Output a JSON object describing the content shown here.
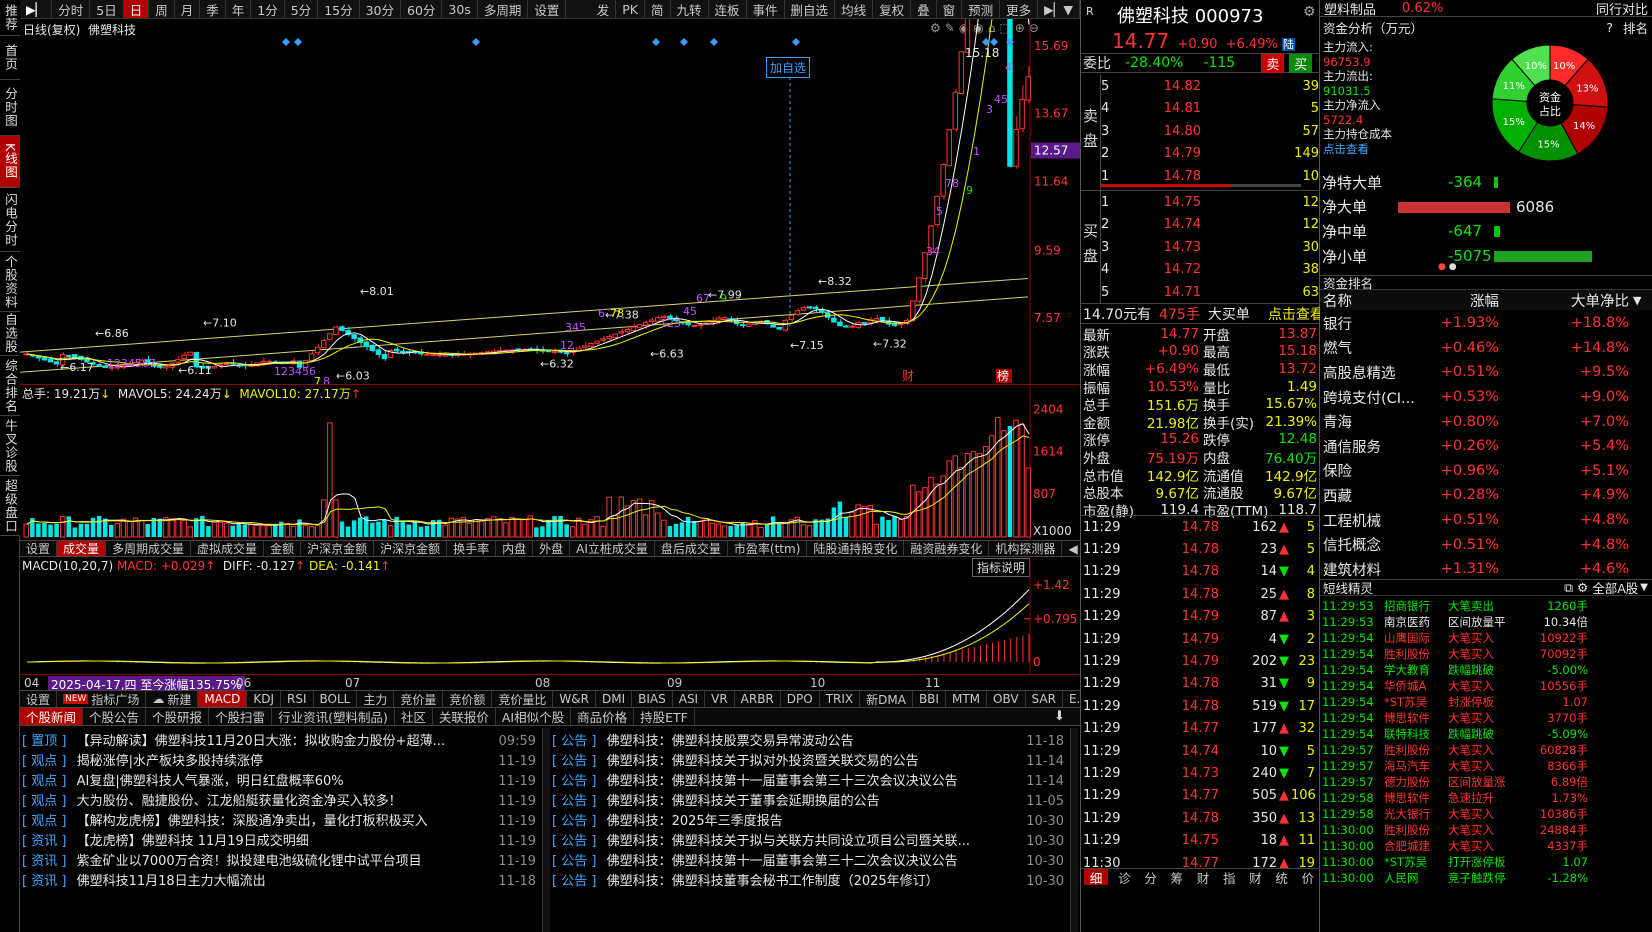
{
  "toolbar": {
    "left": [
      "分时",
      "5日",
      "日",
      "周",
      "月",
      "季",
      "年",
      "1分",
      "5分",
      "15分",
      "30分",
      "60分",
      "30s",
      "多周期",
      "设置"
    ],
    "active": 2,
    "right": [
      "发",
      "PK",
      "简",
      "九转",
      "连板",
      "事件",
      "删自选",
      "均线",
      "复权",
      "叠",
      "窗",
      "预测",
      "更多"
    ]
  },
  "sidebar": [
    "推荐",
    "首页",
    "分时图",
    "K线图",
    "闪电分时",
    "个股资料",
    "自选股",
    "综合排名",
    "牛叉诊股",
    "超级盘口"
  ],
  "sidebar_active": 3,
  "kline": {
    "title_left": "日线(复权)",
    "stock_name": "佛塑科技",
    "price_labels": [
      "15.69",
      "13.67",
      "12.57",
      "11.64",
      "9.59",
      "7.57"
    ],
    "marks": {
      "high": "15.18",
      "p801": "8.01",
      "p832": "8.32",
      "p799": "7.99",
      "p738": "7.38",
      "p715": "7.15",
      "p732": "7.32",
      "p710": "7.10",
      "p686": "6.86",
      "p617": "6.17",
      "p611": "6.11",
      "p603": "6.03",
      "p632": "6.32",
      "p663": "6.63"
    },
    "add_watch": "加自选",
    "cai": "财",
    "bang": "榜"
  },
  "volume": {
    "label_main": "总手: 19.21万",
    "label_mavol5": "MAVOL5: 24.24万",
    "label_mavol10": "MAVOL10: 27.17万",
    "ticks": [
      "2404",
      "1614",
      "807",
      "X1000"
    ]
  },
  "ind_tabs": [
    "设置",
    "成交量",
    "多周期成交量",
    "虚拟成交量",
    "金额",
    "沪深京金额",
    "沪深京金额",
    "换手率",
    "内盘",
    "外盘",
    "AI立桩成交量",
    "盘后成交量",
    "市盈率(ttm)",
    "陆股通持股变化",
    "融资融券变化",
    "机构探测器"
  ],
  "ind_tabs_active": 1,
  "macd": {
    "label": "MACD(10,20,7)",
    "macd": "MACD: +0.029",
    "diff": "DIFF: -0.127",
    "dea": "DEA: -0.141",
    "btn": "指标说明",
    "ticks": [
      "+1.42",
      "+0.795",
      "0"
    ]
  },
  "xaxis": {
    "labels": [
      "04",
      "2025-04-17,四 至今涨幅135.75%",
      "06",
      "07",
      "08",
      "09",
      "10",
      "11"
    ]
  },
  "ind_bar": [
    "设置",
    "指标广场",
    "新建",
    "MACD",
    "KDJ",
    "RSI",
    "BOLL",
    "主力",
    "竞价量",
    "竞价额",
    "竞价量比",
    "W&R",
    "DMI",
    "BIAS",
    "ASI",
    "VR",
    "ARBR",
    "DPO",
    "TRIX",
    "新DMA",
    "BBI",
    "MTM",
    "OBV",
    "SAR",
    "E..."
  ],
  "ind_bar_new": "NEW",
  "news_tabs": [
    "个股新闻",
    "个股公告",
    "个股研报",
    "个股扫雷",
    "行业资讯(塑料制品)",
    "社区",
    "关联报价",
    "AI相似个股",
    "商品价格",
    "持股ETF"
  ],
  "news_left": [
    {
      "tag": "置顶",
      "text": "【异动解读】佛塑科技11月20日大涨：拟收购金力股份+超薄...",
      "date": "09:59"
    },
    {
      "tag": "观点",
      "text": "揭秘涨停|水产板块多股持续涨停",
      "date": "11-19"
    },
    {
      "tag": "观点",
      "text": "AI复盘|佛塑科技人气暴涨，明日红盘概率60%",
      "date": "11-19"
    },
    {
      "tag": "观点",
      "text": "大为股份、融捷股份、江龙船艇获量化资金净买入较多！",
      "date": "11-19"
    },
    {
      "tag": "观点",
      "text": "【解构龙虎榜】佛塑科技：深股通净卖出，量化打板积极买入",
      "date": "11-19"
    },
    {
      "tag": "资讯",
      "text": "【龙虎榜】佛塑科技 11月19日成交明细",
      "date": "11-19"
    },
    {
      "tag": "资讯",
      "text": "紫金矿业以7000万合资！拟投建电池级硫化锂中试平台项目",
      "date": "11-19"
    },
    {
      "tag": "资讯",
      "text": "佛塑科技11月18日主力大幅流出",
      "date": "11-18"
    }
  ],
  "news_right": [
    {
      "tag": "公告",
      "text": "佛塑科技：佛塑科技股票交易异常波动公告",
      "date": "11-18"
    },
    {
      "tag": "公告",
      "text": "佛塑科技：佛塑科技关于拟对外投资暨关联交易的公告",
      "date": "11-14"
    },
    {
      "tag": "公告",
      "text": "佛塑科技：佛塑科技第十一届董事会第三十三次会议决议公告",
      "date": "11-14"
    },
    {
      "tag": "公告",
      "text": "佛塑科技：佛塑科技关于董事会延期换届的公告",
      "date": "11-05"
    },
    {
      "tag": "公告",
      "text": "佛塑科技：2025年三季度报告",
      "date": "10-30"
    },
    {
      "tag": "公告",
      "text": "佛塑科技：佛塑科技关于拟与关联方共同设立项目公司暨关联...",
      "date": "10-30"
    },
    {
      "tag": "公告",
      "text": "佛塑科技：佛塑科技第十一届董事会第三十二次会议决议公告",
      "date": "10-30"
    },
    {
      "tag": "公告",
      "text": "佛塑科技：佛塑科技董事会秘书工作制度（2025年修订）",
      "date": "10-30"
    }
  ],
  "quote": {
    "r": "R",
    "name": "佛塑科技",
    "code": "000973",
    "price": "14.77",
    "chg": "+0.90",
    "pct": "+6.49%",
    "lu": "陆",
    "weibi_label": "委比",
    "weibi": "-28.40%",
    "weicha": "-115",
    "sell": "卖",
    "buy": "买",
    "sell_label": "卖盘",
    "buy_label": "买盘",
    "asks": [
      {
        "n": "5",
        "p": "14.82",
        "v": "39"
      },
      {
        "n": "4",
        "p": "14.81",
        "v": "5"
      },
      {
        "n": "3",
        "p": "14.80",
        "v": "57"
      },
      {
        "n": "2",
        "p": "14.79",
        "v": "149"
      },
      {
        "n": "1",
        "p": "14.78",
        "v": "10"
      }
    ],
    "bids": [
      {
        "n": "1",
        "p": "14.75",
        "v": "12"
      },
      {
        "n": "2",
        "p": "14.74",
        "v": "12"
      },
      {
        "n": "3",
        "p": "14.73",
        "v": "30"
      },
      {
        "n": "4",
        "p": "14.72",
        "v": "38"
      },
      {
        "n": "5",
        "p": "14.71",
        "v": "63"
      }
    ],
    "bigorder": {
      "a": "14.70元有",
      "b": "475手",
      "c": "大买单",
      "d": "点击查看"
    },
    "stats": [
      [
        "最新",
        "14.77",
        "开盘",
        "13.87"
      ],
      [
        "涨跌",
        "+0.90",
        "最高",
        "15.18"
      ],
      [
        "涨幅",
        "+6.49%",
        "最低",
        "13.72"
      ],
      [
        "振幅",
        "10.53%",
        "量比",
        "1.49"
      ],
      [
        "总手",
        "151.6万",
        "换手",
        "15.67%"
      ],
      [
        "金额",
        "21.98亿",
        "换手(实)",
        "21.39%"
      ],
      [
        "涨停",
        "15.26",
        "跌停",
        "12.48"
      ],
      [
        "外盘",
        "75.19万",
        "内盘",
        "76.40万"
      ],
      [
        "总市值",
        "142.9亿",
        "流通值",
        "142.9亿"
      ],
      [
        "总股本",
        "9.67亿",
        "流通股",
        "9.67亿"
      ],
      [
        "市盈(静)",
        "119.4",
        "市盈(TTM)",
        "118.7"
      ]
    ],
    "trades": [
      [
        "11:29",
        "14.78",
        "162",
        "5"
      ],
      [
        "11:29",
        "14.78",
        "23",
        "5"
      ],
      [
        "11:29",
        "14.78",
        "14",
        "4"
      ],
      [
        "11:29",
        "14.78",
        "25",
        "8"
      ],
      [
        "11:29",
        "14.79",
        "87",
        "3"
      ],
      [
        "11:29",
        "14.79",
        "4",
        "2"
      ],
      [
        "11:29",
        "14.79",
        "202",
        "23"
      ],
      [
        "11:29",
        "14.78",
        "31",
        "9"
      ],
      [
        "11:29",
        "14.78",
        "519",
        "17"
      ],
      [
        "11:29",
        "14.77",
        "177",
        "32"
      ],
      [
        "11:29",
        "14.74",
        "10",
        "5"
      ],
      [
        "11:29",
        "14.73",
        "240",
        "7"
      ],
      [
        "11:29",
        "14.77",
        "505",
        "106"
      ],
      [
        "11:29",
        "14.78",
        "350",
        "13"
      ],
      [
        "11:29",
        "14.75",
        "18",
        "11"
      ],
      [
        "11:30",
        "14.77",
        "172",
        "19"
      ]
    ],
    "bottom_tabs": [
      "细",
      "诊",
      "分",
      "筹",
      "财",
      "指",
      "财",
      "统",
      "价"
    ]
  },
  "fund": {
    "sector": "塑料制品",
    "sector_pct": "0.62%",
    "peer": "同行对比",
    "title": "资金分析（万元）",
    "help": "?",
    "rank": "排名",
    "inflow_label": "主力流入:",
    "inflow": "96753.9",
    "outflow_label": "主力流出:",
    "outflow": "91031.5",
    "net_label": "主力净流入",
    "net": "5722.4",
    "cost_label": "主力持仓成本",
    "cost_link": "点击查看",
    "donut_center": "资金占比",
    "donut": [
      "10%",
      "10%",
      "11%",
      "15%",
      "15%",
      "14%",
      "13%"
    ],
    "flows": [
      {
        "label": "净特大单",
        "val": "-364"
      },
      {
        "label": "净大单",
        "val": "6086"
      },
      {
        "label": "净中单",
        "val": "-647"
      },
      {
        "label": "净小单",
        "val": "-5075"
      }
    ]
  },
  "sector_rank": {
    "title": "资金排名",
    "cols": [
      "名称",
      "涨幅",
      "大单净比"
    ],
    "rows": [
      [
        "银行",
        "+1.93%",
        "+18.8%"
      ],
      [
        "燃气",
        "+0.46%",
        "+14.8%"
      ],
      [
        "高股息精选",
        "+0.51%",
        "+9.5%"
      ],
      [
        "跨境支付(CI...",
        "+0.53%",
        "+9.0%"
      ],
      [
        "青海",
        "+0.80%",
        "+7.0%"
      ],
      [
        "通信服务",
        "+0.26%",
        "+5.4%"
      ],
      [
        "保险",
        "+0.96%",
        "+5.1%"
      ],
      [
        "西藏",
        "+0.28%",
        "+4.9%"
      ],
      [
        "工程机械",
        "+0.51%",
        "+4.8%"
      ],
      [
        "信托概念",
        "+0.51%",
        "+4.8%"
      ],
      [
        "建筑材料",
        "+1.31%",
        "+4.6%"
      ]
    ]
  },
  "elves": {
    "title": "短线精灵",
    "market": "全部A股",
    "rows": [
      [
        "11:29:53",
        "招商银行",
        "大笔卖出",
        "1260手",
        "g"
      ],
      [
        "11:29:53",
        "南京医药",
        "区间放量平",
        "10.34倍",
        "w"
      ],
      [
        "11:29:54",
        "山鹰国际",
        "大笔买入",
        "10922手",
        "r"
      ],
      [
        "11:29:54",
        "胜利股份",
        "大笔买入",
        "70092手",
        "r"
      ],
      [
        "11:29:54",
        "学大教育",
        "跌幅跳破",
        "-5.00%",
        "g"
      ],
      [
        "11:29:54",
        "华侨城A",
        "大笔买入",
        "10556手",
        "r"
      ],
      [
        "11:29:54",
        "*ST苏吴",
        "封涨停板",
        "1.07",
        "r"
      ],
      [
        "11:29:54",
        "博思软件",
        "大笔买入",
        "3770手",
        "r"
      ],
      [
        "11:29:54",
        "联特科技",
        "跌幅跳破",
        "-5.09%",
        "g"
      ],
      [
        "11:29:57",
        "胜利股份",
        "大笔买入",
        "60828手",
        "r"
      ],
      [
        "11:29:57",
        "海马汽车",
        "大笔买入",
        "8366手",
        "r"
      ],
      [
        "11:29:57",
        "德力股份",
        "区间放量涨",
        "6.89倍",
        "r"
      ],
      [
        "11:29:58",
        "博思软件",
        "急速拉升",
        "1.73%",
        "r"
      ],
      [
        "11:29:58",
        "光大银行",
        "大笔买入",
        "10386手",
        "r"
      ],
      [
        "11:30:00",
        "胜利股份",
        "大笔买入",
        "24884手",
        "r"
      ],
      [
        "11:30:00",
        "合肥城建",
        "大笔买入",
        "4337手",
        "r"
      ],
      [
        "11:30:00",
        "*ST苏吴",
        "打开涨停板",
        "1.07",
        "g"
      ],
      [
        "11:30:00",
        "人民网",
        "竞子触跌停",
        "-1.28%",
        "g"
      ]
    ]
  },
  "colors": {
    "up": "#ff3232",
    "down": "#00e6e6",
    "accent": "#b00000",
    "ma5": "#ffffff",
    "ma10": "#f0f000"
  }
}
